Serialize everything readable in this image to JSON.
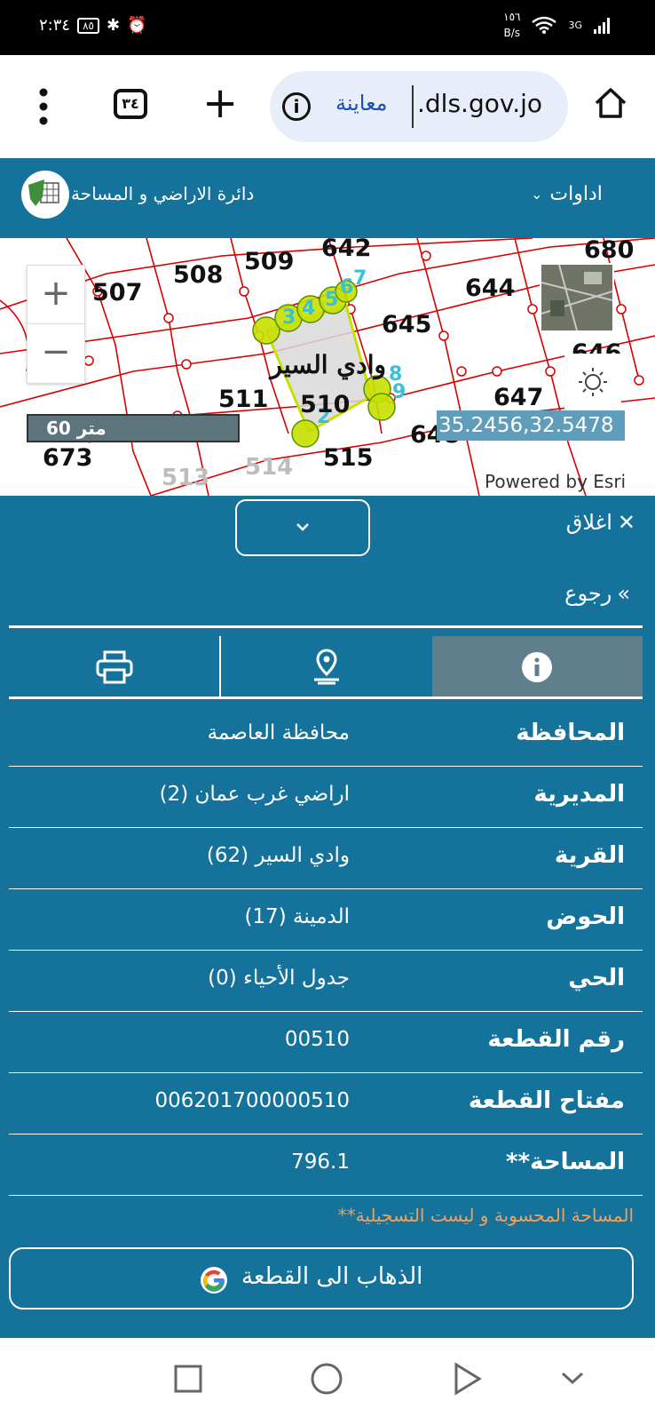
{
  "status": {
    "time": "٢:٣٤",
    "battery": "٨٥",
    "network_speed_value": "١٥٦",
    "network_speed_unit": "B/s",
    "network_type": "3G"
  },
  "browser": {
    "tab_count": "٣٤",
    "page_label": "معاينة",
    "url": ".dls.gov.jo"
  },
  "app": {
    "title": "دائرة الاراضي و المساحة",
    "tools_label": "اداوات"
  },
  "map": {
    "parcel_labels": [
      "509",
      "642",
      "680",
      "508",
      "507",
      "644",
      "645",
      "646",
      "511",
      "510",
      "647",
      "648",
      "673",
      "515",
      "514",
      "513"
    ],
    "village_label": "وادي السير",
    "scale_label": "60 متر",
    "coordinates": "35.2456,32.5478",
    "attribution": "Powered by Esri"
  },
  "panel": {
    "close_label": "اغلاق",
    "back_label": "رجوع",
    "rows": [
      {
        "label": "المحافظة",
        "value": "محافظة العاصمة"
      },
      {
        "label": "المديرية",
        "value": "اراضي غرب عمان (2)"
      },
      {
        "label": "القرية",
        "value": "وادي السير (62)"
      },
      {
        "label": "الحوض",
        "value": "الدمينة (17)"
      },
      {
        "label": "الحي",
        "value": "جدول الأحياء (0)"
      },
      {
        "label": "رقم القطعة",
        "value": "00510"
      },
      {
        "label": "مفتاح القطعة",
        "value": "006201700000510"
      },
      {
        "label": "**المساحة",
        "value": "796.1"
      }
    ],
    "note": "**المساحة المحسوبة و ليست التسجيلية",
    "goto_label": "الذهاب الى القطعة"
  }
}
